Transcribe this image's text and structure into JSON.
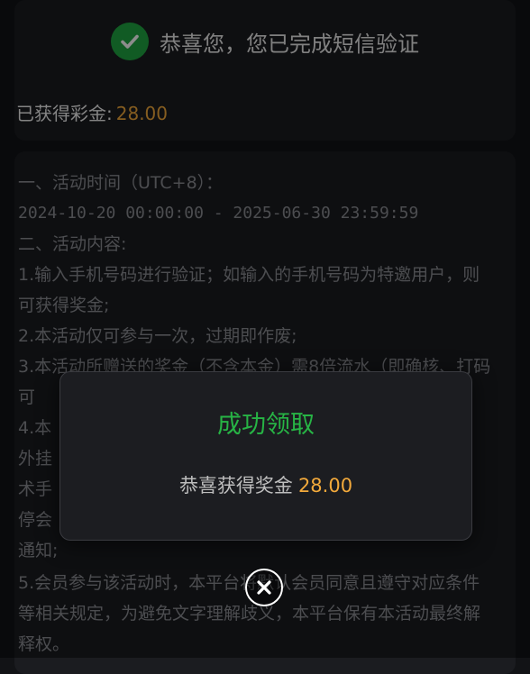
{
  "header": {
    "success_message": "恭喜您，您已完成短信验证",
    "bonus_label": "已获得彩金:",
    "bonus_amount": "28.00"
  },
  "rules": [
    "一、活动时间（UTC+8）：",
    "2024-10-20 00:00:00 - 2025-06-30 23:59:59",
    "二、活动内容:",
    "1.输入手机号码进行验证；如输入的手机号码为特邀用户，则可获得奖金;",
    "2.本活动仅可参与一次，过期即作废;",
    "3.本活动所赠送的奖金（不含本金）需8倍流水（即确核、打码可",
    "4.本",
    "外挂",
    "术手",
    "停会",
    "通知;",
    "5.会员参与该活动时，本平台将默认会员同意且遵守对应条件等相关规定，为避免文字理解歧义，本平台保有本活动最终解释权。"
  ],
  "modal": {
    "title": "成功领取",
    "message_prefix": "恭喜获得奖金",
    "amount": "28.00"
  },
  "colors": {
    "success_green": "#27b445",
    "amount_orange": "#f2a93b"
  },
  "icons": {
    "success": "check-circle-icon",
    "close": "close-icon"
  }
}
